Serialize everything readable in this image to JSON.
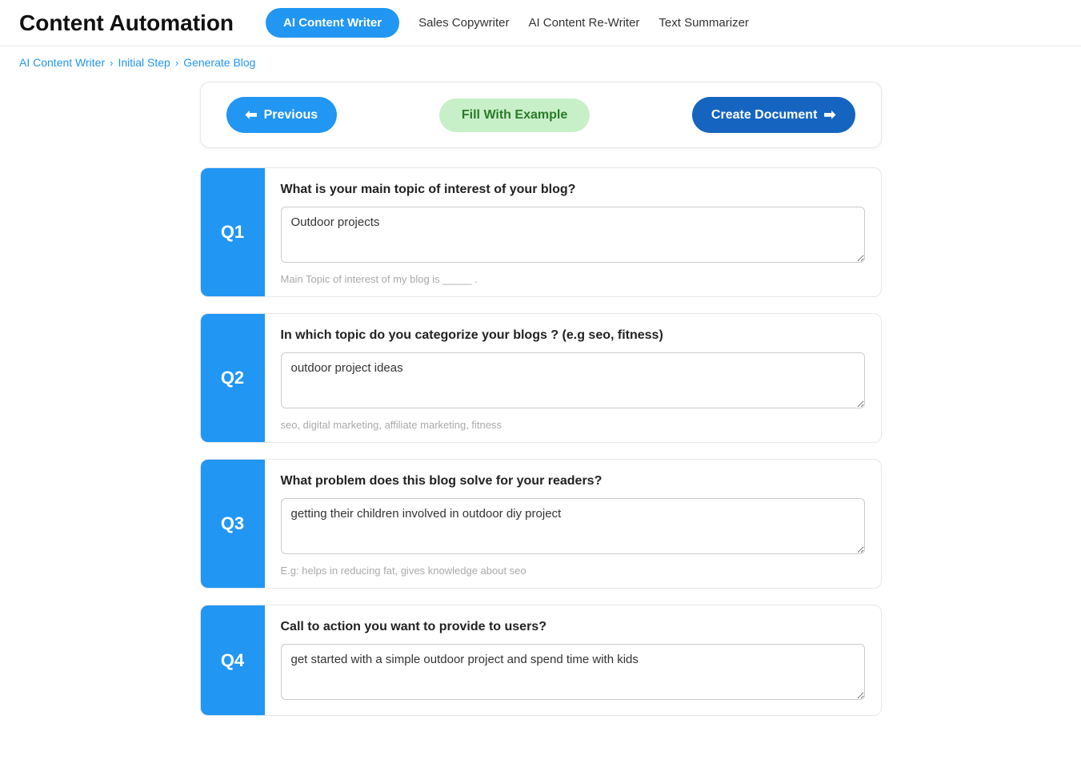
{
  "app": {
    "title": "Content Automation"
  },
  "nav": {
    "tabs": [
      {
        "id": "ai-content-writer",
        "label": "AI Content Writer",
        "active": true
      },
      {
        "id": "sales-copywriter",
        "label": "Sales Copywriter",
        "active": false
      },
      {
        "id": "ai-content-rewriter",
        "label": "AI Content Re-Writer",
        "active": false
      },
      {
        "id": "text-summarizer",
        "label": "Text Summarizer",
        "active": false
      }
    ]
  },
  "breadcrumb": {
    "items": [
      {
        "id": "ai-content-writer",
        "label": "AI Content Writer"
      },
      {
        "id": "initial-step",
        "label": "Initial Step"
      },
      {
        "id": "generate-blog",
        "label": "Generate Blog"
      }
    ]
  },
  "action_bar": {
    "previous_label": "Previous",
    "fill_example_label": "Fill With Example",
    "create_doc_label": "Create Document"
  },
  "questions": [
    {
      "id": "q1",
      "label": "Q1",
      "title": "What is your main topic of interest of your blog?",
      "value": "Outdoor projects",
      "hint": "Main Topic of interest of my blog is _____ ."
    },
    {
      "id": "q2",
      "label": "Q2",
      "title": "In which topic do you categorize your blogs ? (e.g seo, fitness)",
      "value": "outdoor project ideas",
      "hint": "seo, digital marketing, affiliate marketing, fitness"
    },
    {
      "id": "q3",
      "label": "Q3",
      "title": "What problem does this blog solve for your readers?",
      "value": "getting their children involved in outdoor diy project",
      "hint": "E.g: helps in reducing fat, gives knowledge about seo"
    },
    {
      "id": "q4",
      "label": "Q4",
      "title": "Call to action you want to provide to users?",
      "value": "get started with a simple outdoor project and spend time with kids",
      "hint": ""
    }
  ]
}
